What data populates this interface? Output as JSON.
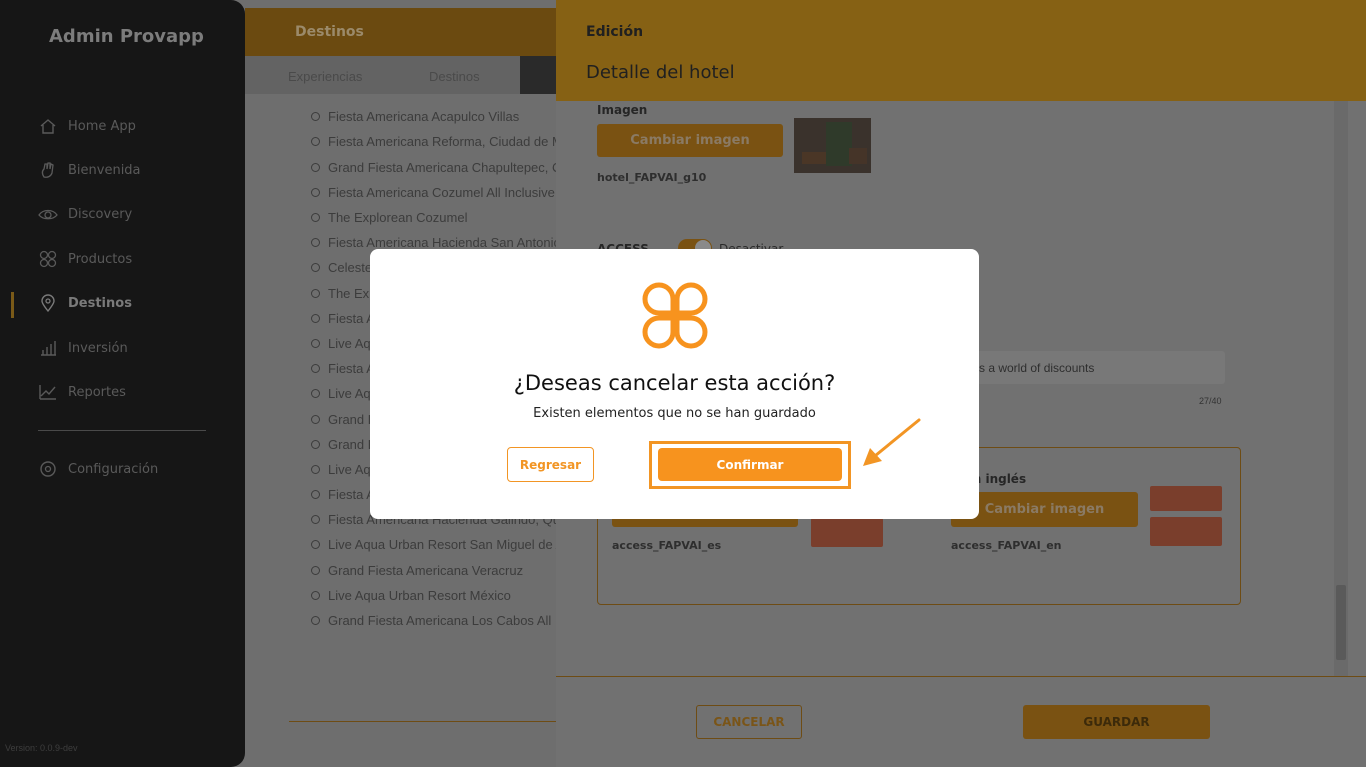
{
  "sidebar": {
    "brand": "Admin Provapp",
    "items": [
      {
        "label": "Home App",
        "icon": "home-icon"
      },
      {
        "label": "Bienvenida",
        "icon": "hand-icon"
      },
      {
        "label": "Discovery",
        "icon": "eye-icon"
      },
      {
        "label": "Productos",
        "icon": "grid-icon"
      },
      {
        "label": "Destinos",
        "icon": "location-pin-icon",
        "active": true
      },
      {
        "label": "Inversión",
        "icon": "bar-chart-icon"
      },
      {
        "label": "Reportes",
        "icon": "line-chart-icon"
      },
      {
        "label": "Configuración",
        "icon": "gear-icon"
      }
    ],
    "version": "Version: 0.0.9-dev"
  },
  "middle": {
    "header": "Destinos",
    "tabs": [
      "Experiencias",
      "Destinos"
    ],
    "items": [
      "Fiesta Americana Acapulco Villas",
      "Fiesta Americana Reforma, Ciudad de M",
      "Grand Fiesta Americana Chapultepec, C",
      "Fiesta Americana Cozumel All Inclusive",
      "The Explorean Cozumel",
      "Fiesta Americana Hacienda San Antonio",
      "Celeste",
      "The Exp",
      "Fiesta A",
      "Live Aqu",
      "Fiesta A",
      "Live Aqu",
      "Grand F",
      "Grand F",
      "Live Aqu",
      "Fiesta A",
      "Fiesta Americana Hacienda Galindo, Que",
      "Live Aqua Urban Resort San Miguel de A",
      "Grand Fiesta Americana Veracruz",
      "Live Aqua Urban Resort México",
      "Grand Fiesta Americana Los Cabos All In"
    ]
  },
  "panel": {
    "section": "Edición",
    "title": "Detalle del hotel",
    "image_label": "Imagen",
    "change_image": "Cambiar imagen",
    "image_file": "hotel_FAPVAI_g10",
    "access_label": "ACCESS",
    "toggle_label": "Desactivar",
    "input_value": "s a world of discounts",
    "counter": "27/40",
    "image_en_label": "gen inglés",
    "change_image_en": "Cambiar imagen",
    "access_es_file": "access_FAPVAI_es",
    "access_en_file": "access_FAPVAI_en",
    "cancel": "CANCELAR",
    "save": "GUARDAR"
  },
  "modal": {
    "title": "¿Deseas cancelar esta acción?",
    "subtitle": "Existen elementos que no se han guardado",
    "back": "Regresar",
    "confirm": "Confirmar",
    "accent": "#f7931e"
  }
}
